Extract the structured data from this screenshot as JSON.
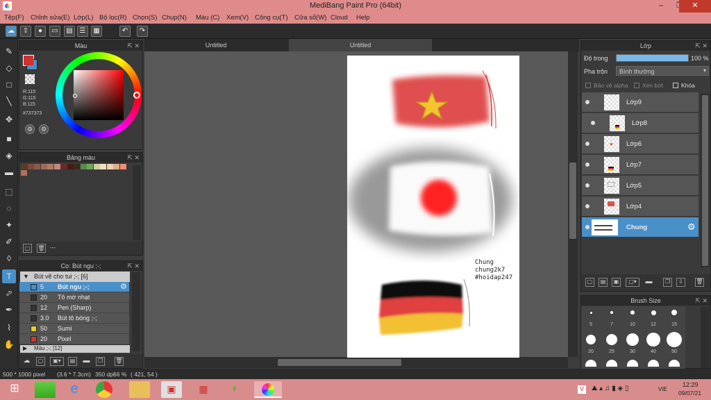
{
  "window": {
    "title": "MediBang Paint Pro (64bit)",
    "minimize": "–",
    "restore": "❐",
    "close": "✕"
  },
  "menu": [
    "Tệp(F)",
    "Chỉnh sửa(E)",
    "Lớp(L)",
    "Bộ lọc(R)",
    "Chọn(S)",
    "Chụp(N)",
    "Màu (C)",
    "Xem(V)",
    "Công cụ(T)",
    "Cửa sổ(W)",
    "Cloud",
    "Help"
  ],
  "color_panel": {
    "title": "Màu",
    "r": "R:115",
    "g": "G:115",
    "b": "B:115",
    "hex": "#737373",
    "fg_color": "#d03030",
    "bg_color": "#4a90c8"
  },
  "palette_panel": {
    "title": "Bảng màu",
    "swatches": [
      "#5a3a2a",
      "#7a4a3a",
      "#8a5a4a",
      "#a06a5a",
      "#b07a6a",
      "#c08a7a",
      "#6a2a2a",
      "#4a1a1a",
      "#3a2a1a",
      "#5a8a4a",
      "#6aaa5a",
      "#d0d0a0",
      "#f0e0c0",
      "#f0d0b0",
      "#e0b090",
      "#f09070",
      "#b07060"
    ],
    "footer_text": "---"
  },
  "brush_panel": {
    "title": "Cọ: Bút ngu ;-;",
    "group1": "Bút vẽ cho tui ;-; [6]",
    "group2": "Màu ;-; [12]",
    "rows": [
      {
        "size": "5",
        "name": "Bút ngu ;-;",
        "color": "#4a90c8"
      },
      {
        "size": "20",
        "name": "Tô mờ nhạt",
        "color": "#333333"
      },
      {
        "size": "12",
        "name": "Pen (Sharp)",
        "color": "#333333"
      },
      {
        "size": "3.0",
        "name": "Bút tô bóng ;-;",
        "color": "#333333"
      },
      {
        "size": "50",
        "name": "Sumi",
        "color": "#e8d020"
      },
      {
        "size": "20",
        "name": "Pixel",
        "color": "#e03030"
      }
    ]
  },
  "tabs": {
    "tab1": "Untitled",
    "tab2": "Untitled"
  },
  "canvas": {
    "text1": "Chung",
    "text2": "chung2k7",
    "text3": "#hoidap247"
  },
  "layer_panel": {
    "title": "Lớp",
    "opacity_label": "Độ trong",
    "opacity_value": "100 %",
    "opacity": 1.0,
    "blend_label": "Pha trộn",
    "blend_value": "Bình thường",
    "protect_alpha": "Bảo vệ alpha",
    "clipping": "Xén bớt",
    "lock": "Khóa",
    "layers": [
      "Lớp9",
      "Lớp8",
      "Lớp6",
      "Lớp7",
      "Lớp5",
      "Lớp4",
      "Chung"
    ]
  },
  "brush_size_panel": {
    "title": "Brush Size",
    "row1": [
      "5",
      "7",
      "10",
      "12",
      "15"
    ],
    "row2": [
      "20",
      "25",
      "30",
      "40",
      "50"
    ]
  },
  "status": {
    "size": "500 * 1000 pixel",
    "cm": "(3.6 * 7.3cm)",
    "dpi": "350 dpi",
    "zoom": "66 %",
    "coords": "( 421, 54 )"
  },
  "taskbar": {
    "lang": "VIE",
    "time": "12:29",
    "date": "09/07/21"
  }
}
